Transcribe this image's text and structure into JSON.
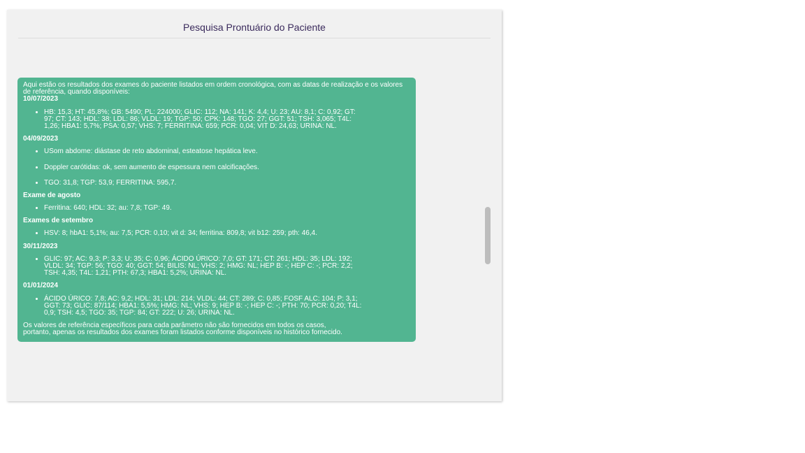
{
  "header": {
    "title": "Pesquisa Prontuário do Paciente"
  },
  "message": {
    "intro": "Aqui estão os resultados dos exames do paciente listados em ordem cronológica, com as datas de realização e os valores de referência, quando disponíveis:",
    "sections": [
      {
        "heading": "10/07/2023",
        "items": [
          "HB: 15,3; HT: 45,8%; GB: 5490; PL: 224000; GLIC: 112; NA: 141; K: 4,4; U: 23; AU: 8,1; C: 0,92; GT: 97; CT: 143; HDL: 38; LDL: 86; VLDL: 19; TGP: 50; CPK: 148; TGO: 27; GGT: 51; TSH: 3,065; T4L: 1,26; HBA1: 5,7%; PSA: 0,57; VHS: 7; FERRITINA: 659; PCR: 0,04; VIT D: 24,63; URINA: NL."
        ]
      },
      {
        "heading": "04/09/2023",
        "items": [
          "USom abdome: diástase de reto abdominal, esteatose hepática leve.",
          "Doppler carótidas: ok, sem aumento de espessura nem calcificações.",
          "TGO: 31,8; TGP: 53,9; FERRITINA: 595,7."
        ]
      },
      {
        "heading": "Exame de agosto",
        "items": [
          "Ferritina: 640; HDL: 32; au: 7,8; TGP: 49."
        ]
      },
      {
        "heading": "Exames de setembro",
        "items": [
          "HSV: 8; hbA1: 5,1%; au: 7,5; PCR: 0,10; vit d: 34; ferritina: 809,8; vit b12: 259; pth: 46,4."
        ]
      },
      {
        "heading": "30/11/2023",
        "items": [
          "GLIC: 97; AC: 9,3; P: 3,3; U: 35; C: 0,96; ÁCIDO ÚRICO: 7,0; GT: 171; CT: 261; HDL: 35; LDL: 192; VLDL: 34; TGP: 56; TGO: 40; GGT: 54; BILIS: NL; VHS: 2; HMG: NL; HEP B: -; HEP C: -; PCR: 2,2; TSH: 4,35; T4L: 1,21; PTH: 67,3; HBA1: 5,2%; URINA: NL."
        ]
      },
      {
        "heading": "01/01/2024",
        "items": [
          "ÁCIDO ÚRICO: 7,8; AC: 9,2; HDL: 31; LDL: 214; VLDL: 44; CT: 289; C: 0,85; FOSF ALC: 104; P: 3,1; GGT: 73; GLIC: 87/114; HBA1: 5,5%; HMG: NL; VHS: 9; HEP B: -; HEP C: -; PTH: 70; PCR: 0,20; T4L: 0,9; TSH: 4,5; TGO: 35; TGP: 84; GT: 222; U: 26; URINA: NL."
        ]
      }
    ],
    "outro": "Os valores de referência específicos para cada parâmetro não são fornecidos em todos os casos, portanto, apenas os resultados dos exames foram listados conforme disponíveis no histórico fornecido."
  },
  "colors": {
    "message_bg": "#52b591",
    "panel_bg": "#f1f1f1",
    "title": "#3a2a5c"
  }
}
